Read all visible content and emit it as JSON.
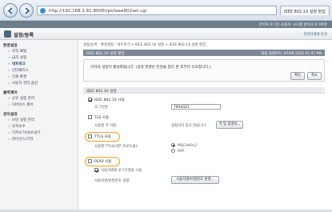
{
  "browser": {
    "url": "http://192.168.1.81:8000/rps/ieee802set.cgi",
    "tab_title": "IEEE 802.1X 설정 편집"
  },
  "header": {
    "top_strip": "관리자  로그인 사용자: 시스템 관리자  로그아웃",
    "title": "설정/등록",
    "link": "관리자에게 문의"
  },
  "sidebar": {
    "groups": [
      {
        "title": "환경설정",
        "items": [
          "조작 패널",
          "급지 설정",
          "네트워크",
          "인터페이스",
          "인쇄 환경",
          "사용자 관리 옵션"
        ]
      },
      {
        "title": "출력제어",
        "items": [
          "공유 설정 관리",
          "디바이스 제어"
        ]
      },
      {
        "title": "관리설정",
        "items": [
          "보안 설정 관리",
          "유지보수",
          "가져오기/내보내기",
          "라이선스/기타"
        ]
      }
    ],
    "active_item": "네트워크"
  },
  "main": {
    "breadcrumb": "설정/등록 : 환경설정 : 네트워크 > IEEE 802.1X 설정 > IEEE 802.1X 설정 편집",
    "section_title": "IEEE 802.1X 설정 편집",
    "section_time": "최종 업데이트: 07/09 2015 01:47 PM",
    "notice": "이하의 설정이 활성화됩니다. (설정 변경은 전원을 껐다 켠 후부터 유효합니다.)",
    "ok_label": "확인",
    "cancel_label": "취소",
    "settings_title": "IEEE 802.1X 설정",
    "use_ieee": "IEEE 802.1X 사용",
    "login_name_label": "로그인명:",
    "login_name_value": "7654321",
    "tls_label": "TLS 사용",
    "tls_key_label": "사용할 키 이름:",
    "tls_key_status": "설정되어 있지 않습니다.",
    "key_cert_button": "키 및 증명서...",
    "ttls_label": "TTLS 사용",
    "ttls_protocol_label": "사용할 TTLS(내부 프로토콜):",
    "ttls_option_1": "MSCHAPv2",
    "ttls_option_2": "PAP",
    "peap_label": "PEAP 사용",
    "peap_use_login": "사용자명에 로그인명을 사용",
    "peap_user_label": "사용자명/비밀번호 설정:",
    "peap_user_button": "사용자명/비밀번호 변경..."
  }
}
